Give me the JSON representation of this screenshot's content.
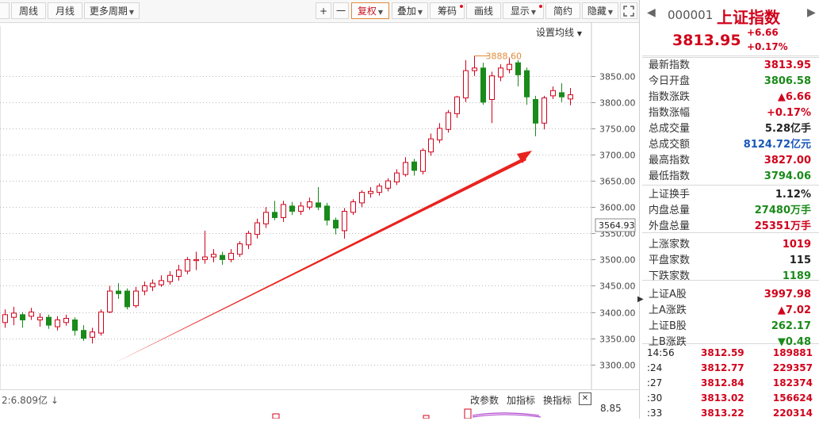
{
  "toolbar": {
    "items": [
      {
        "label": "周线"
      },
      {
        "label": "月线"
      },
      {
        "label": "更多周期"
      },
      {
        "label": "+"
      },
      {
        "label": "一"
      },
      {
        "label": "复权"
      },
      {
        "label": "叠加"
      },
      {
        "label": "筹码"
      },
      {
        "label": "画线"
      },
      {
        "label": "显示"
      },
      {
        "label": "简约"
      },
      {
        "label": "隐藏"
      }
    ],
    "ma_settings": "设置均线"
  },
  "chart_data": {
    "type": "candlestick",
    "ylim": [
      3280,
      3910
    ],
    "y_ticks": [
      3300,
      3350,
      3400,
      3450,
      3500,
      3550,
      3600,
      3650,
      3700,
      3750,
      3800,
      3850
    ],
    "y_tick_labels": [
      "3300.00",
      "3350.00",
      "3400.00",
      "3450.00",
      "3500.00",
      "3550.00",
      "3600.00",
      "3650.00",
      "3700.00",
      "3750.00",
      "3800.00",
      "3850.00"
    ],
    "current_price_label": "3564.93",
    "max_annotation": "3888.60",
    "candles": [
      [
        3380,
        3395,
        3405,
        3370
      ],
      [
        3390,
        3398,
        3410,
        3375
      ],
      [
        3395,
        3385,
        3400,
        3370
      ],
      [
        3392,
        3400,
        3408,
        3385
      ],
      [
        3385,
        3390,
        3398,
        3372
      ],
      [
        3390,
        3375,
        3395,
        3368
      ],
      [
        3372,
        3385,
        3392,
        3365
      ],
      [
        3380,
        3388,
        3395,
        3374
      ],
      [
        3385,
        3365,
        3390,
        3355
      ],
      [
        3365,
        3350,
        3375,
        3345
      ],
      [
        3352,
        3362,
        3370,
        3340
      ],
      [
        3360,
        3400,
        3405,
        3355
      ],
      [
        3400,
        3440,
        3450,
        3398
      ],
      [
        3440,
        3435,
        3455,
        3425
      ],
      [
        3440,
        3410,
        3445,
        3405
      ],
      [
        3412,
        3440,
        3448,
        3408
      ],
      [
        3440,
        3450,
        3458,
        3432
      ],
      [
        3448,
        3455,
        3462,
        3440
      ],
      [
        3452,
        3460,
        3470,
        3448
      ],
      [
        3458,
        3470,
        3478,
        3452
      ],
      [
        3468,
        3480,
        3490,
        3460
      ],
      [
        3478,
        3500,
        3505,
        3472
      ],
      [
        3498,
        3500,
        3515,
        3480
      ],
      [
        3500,
        3505,
        3555,
        3492
      ],
      [
        3505,
        3510,
        3520,
        3495
      ],
      [
        3508,
        3500,
        3515,
        3490
      ],
      [
        3500,
        3512,
        3520,
        3495
      ],
      [
        3510,
        3530,
        3535,
        3505
      ],
      [
        3528,
        3550,
        3555,
        3520
      ],
      [
        3548,
        3570,
        3578,
        3540
      ],
      [
        3568,
        3590,
        3600,
        3560
      ],
      [
        3590,
        3580,
        3612,
        3575
      ],
      [
        3580,
        3605,
        3612,
        3572
      ],
      [
        3602,
        3592,
        3610,
        3585
      ],
      [
        3592,
        3602,
        3610,
        3585
      ],
      [
        3600,
        3610,
        3618,
        3595
      ],
      [
        3608,
        3600,
        3638,
        3594
      ],
      [
        3602,
        3575,
        3608,
        3565
      ],
      [
        3575,
        3560,
        3580,
        3548
      ],
      [
        3555,
        3592,
        3598,
        3540
      ],
      [
        3590,
        3610,
        3615,
        3585
      ],
      [
        3608,
        3628,
        3632,
        3600
      ],
      [
        3626,
        3630,
        3638,
        3618
      ],
      [
        3628,
        3640,
        3645,
        3622
      ],
      [
        3636,
        3650,
        3655,
        3630
      ],
      [
        3648,
        3665,
        3672,
        3642
      ],
      [
        3662,
        3685,
        3695,
        3658
      ],
      [
        3686,
        3670,
        3692,
        3660
      ],
      [
        3668,
        3708,
        3712,
        3662
      ],
      [
        3705,
        3730,
        3740,
        3698
      ],
      [
        3728,
        3750,
        3760,
        3722
      ],
      [
        3748,
        3780,
        3785,
        3742
      ],
      [
        3778,
        3810,
        3812,
        3770
      ],
      [
        3808,
        3860,
        3880,
        3800
      ],
      [
        3860,
        3865,
        3888,
        3850
      ],
      [
        3865,
        3800,
        3875,
        3795
      ],
      [
        3805,
        3850,
        3858,
        3760
      ],
      [
        3848,
        3865,
        3872,
        3840
      ],
      [
        3862,
        3872,
        3885,
        3855
      ],
      [
        3875,
        3852,
        3880,
        3830
      ],
      [
        3860,
        3810,
        3866,
        3795
      ],
      [
        3805,
        3760,
        3812,
        3735
      ],
      [
        3760,
        3808,
        3812,
        3748
      ],
      [
        3812,
        3822,
        3830,
        3806
      ],
      [
        3818,
        3810,
        3836,
        3800
      ],
      [
        3806,
        3814,
        3827,
        3794
      ]
    ]
  },
  "arrow": {
    "color": "#e8231f"
  },
  "bottom_bar": {
    "left_text": "2:6.809亿 ↓",
    "change_params": "改参数",
    "add_indicator": "加指标",
    "switch_indicator": "换指标",
    "close": "✕",
    "right_value": "8.85"
  },
  "quote": {
    "code": "000001",
    "name": "上证指数",
    "price": "3813.95",
    "change": "+6.66",
    "change_pct": "+0.17%",
    "rows": [
      {
        "k": "最新指数",
        "v": "3813.95",
        "c": "red"
      },
      {
        "k": "今日开盘",
        "v": "3806.58",
        "c": "green"
      },
      {
        "k": "指数涨跌",
        "v": "▲6.66",
        "c": "red"
      },
      {
        "k": "指数涨幅",
        "v": "+0.17%",
        "c": "red"
      },
      {
        "k": "总成交量",
        "v": "5.28亿手",
        "c": "dark"
      },
      {
        "k": "总成交额",
        "v": "8124.72亿元",
        "c": "blue"
      },
      {
        "k": "最高指数",
        "v": "3827.00",
        "c": "red"
      },
      {
        "k": "最低指数",
        "v": "3794.06",
        "c": "green"
      },
      {
        "k": "上证换手",
        "v": "1.12%",
        "c": "dark"
      },
      {
        "k": "内盘总量",
        "v": "27480万手",
        "c": "green"
      },
      {
        "k": "外盘总量",
        "v": "25351万手",
        "c": "red"
      },
      {
        "k": "上涨家数",
        "v": "1019",
        "c": "red"
      },
      {
        "k": "平盘家数",
        "v": "115",
        "c": "dark"
      },
      {
        "k": "下跌家数",
        "v": "1189",
        "c": "green"
      },
      {
        "k": "上证A股",
        "v": "3997.98",
        "c": "red"
      },
      {
        "k": "上A涨跌",
        "v": "▲7.02",
        "c": "red"
      },
      {
        "k": "上证B股",
        "v": "262.17",
        "c": "green"
      },
      {
        "k": "上B涨跌",
        "v": "▼0.48",
        "c": "green"
      }
    ],
    "trades": [
      {
        "t": "14:56",
        "p": "3812.59",
        "v": "189881"
      },
      {
        "t": ":24",
        "p": "3812.77",
        "v": "229357"
      },
      {
        "t": ":27",
        "p": "3812.84",
        "v": "182374"
      },
      {
        "t": ":30",
        "p": "3813.02",
        "v": "156624"
      },
      {
        "t": ":33",
        "p": "3813.22",
        "v": "220314"
      }
    ]
  }
}
